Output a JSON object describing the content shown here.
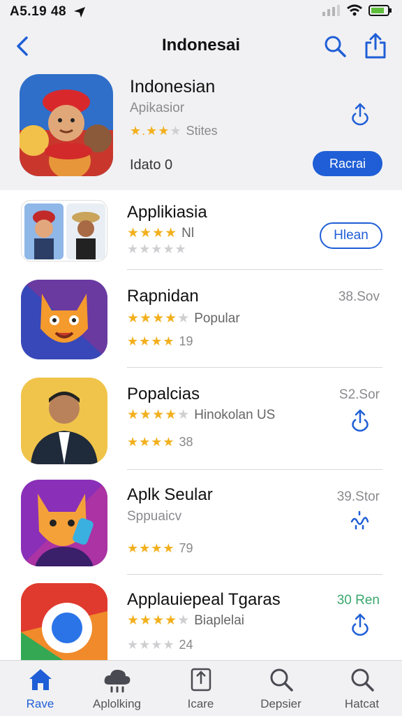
{
  "status": {
    "time": "A5.19 48"
  },
  "nav": {
    "title": "Indonesai"
  },
  "featured": {
    "title": "Indonesian",
    "subtitle": "Apikasior",
    "rating_text": "Stites",
    "info": "Idato 0",
    "button_label": "Racrai",
    "rating": 3.5
  },
  "apps": [
    {
      "name": "Applikiasia",
      "line1": "Nl",
      "line1_rating": 4,
      "line2": "",
      "line2_rating": 0,
      "meta": "",
      "action": "button",
      "button_label": "Hlean"
    },
    {
      "name": "Rapnidan",
      "line1": "Popular",
      "line1_rating": 4,
      "line2": "19",
      "line2_rating": 5,
      "meta": "38.Sov",
      "action": "none"
    },
    {
      "name": "Popalcias",
      "line1": "Hinokolan US",
      "line1_rating": 4,
      "line2": "38",
      "line2_rating": 5,
      "meta": "S2.Sor",
      "action": "share"
    },
    {
      "name": "Aplk Seular",
      "line1": "Sppuaicv",
      "line1_rating": 0,
      "line2": "79",
      "line2_rating": 5,
      "meta": "39.Stor",
      "action": "waves"
    },
    {
      "name": "Applauiepeal Tgaras",
      "line1": "Biaplelai",
      "line1_rating": 4,
      "line2": "24",
      "line2_rating": 0,
      "meta": "30 Ren",
      "meta_color": "#3aa76d",
      "action": "share"
    }
  ],
  "tabs": [
    {
      "label": "Rave",
      "icon": "home-icon",
      "active": true
    },
    {
      "label": "Aplolking",
      "icon": "cloud-icon",
      "active": false
    },
    {
      "label": "Icare",
      "icon": "share-box-icon",
      "active": false
    },
    {
      "label": "Depsier",
      "icon": "search-icon",
      "active": false
    },
    {
      "label": "Hatcat",
      "icon": "search-icon",
      "active": false
    }
  ],
  "colors": {
    "accent": "#1f5ed6",
    "star": "#f2b01e",
    "background": "#f1f1f3",
    "meta_green": "#3aa76d"
  }
}
